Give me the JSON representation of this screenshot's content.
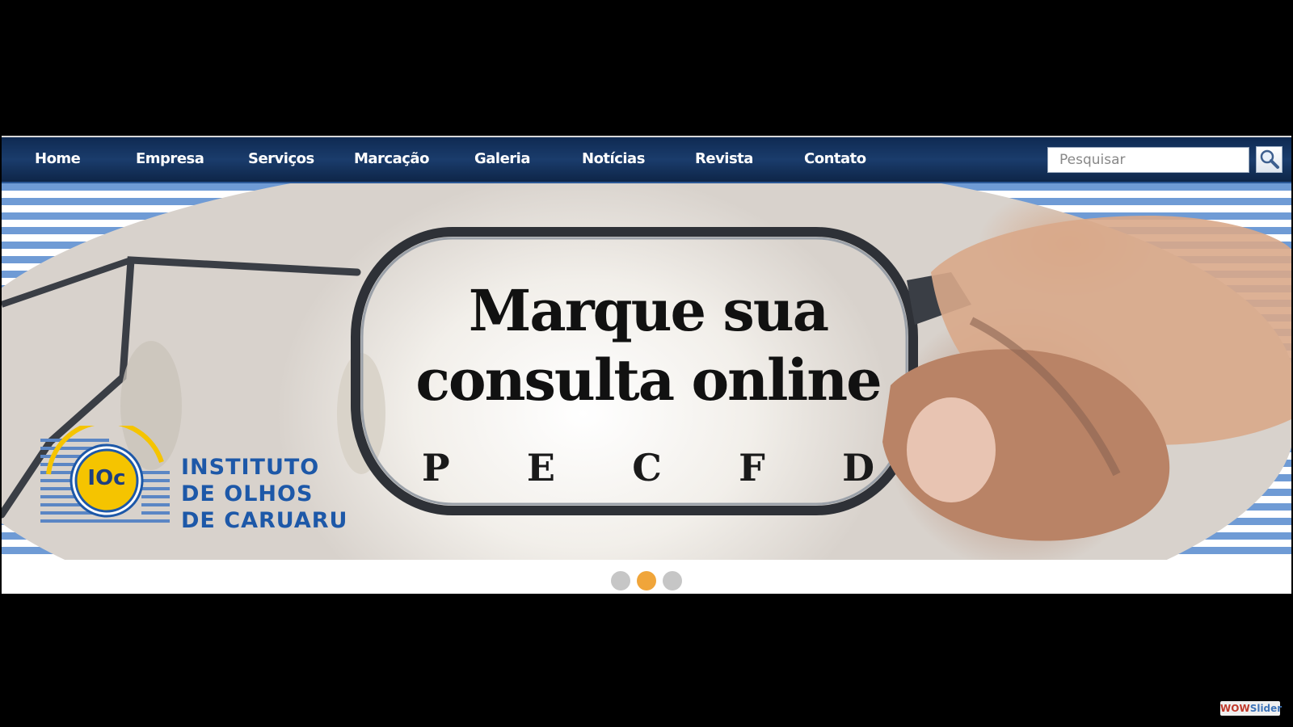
{
  "nav": {
    "items": [
      "Home",
      "Empresa",
      "Serviços",
      "Marcação",
      "Galeria",
      "Notícias",
      "Revista",
      "Contato"
    ]
  },
  "search": {
    "placeholder": "Pesquisar"
  },
  "banner": {
    "headline_line1": "Marque sua",
    "headline_line2": "consulta online",
    "chart_letters": [
      "P",
      "E",
      "C",
      "F",
      "D"
    ],
    "logo": {
      "mark": "IOc",
      "line1": "INSTITUTO",
      "line2": "DE OLHOS",
      "line3": "DE CARUARU"
    }
  },
  "slider": {
    "slide_count": 3,
    "active_slide": 2
  },
  "watermark": {
    "part1": "WOW",
    "part2": "Slider"
  },
  "colors": {
    "nav_background": "#1a3c6c",
    "stripe_blue": "#6f9bd5",
    "logo_blue": "#1d58a8",
    "logo_yellow": "#f5c400",
    "active_dot": "#f0a53a",
    "inactive_dot": "#c6c6c6"
  },
  "icons": {
    "search": "magnifier-icon"
  }
}
